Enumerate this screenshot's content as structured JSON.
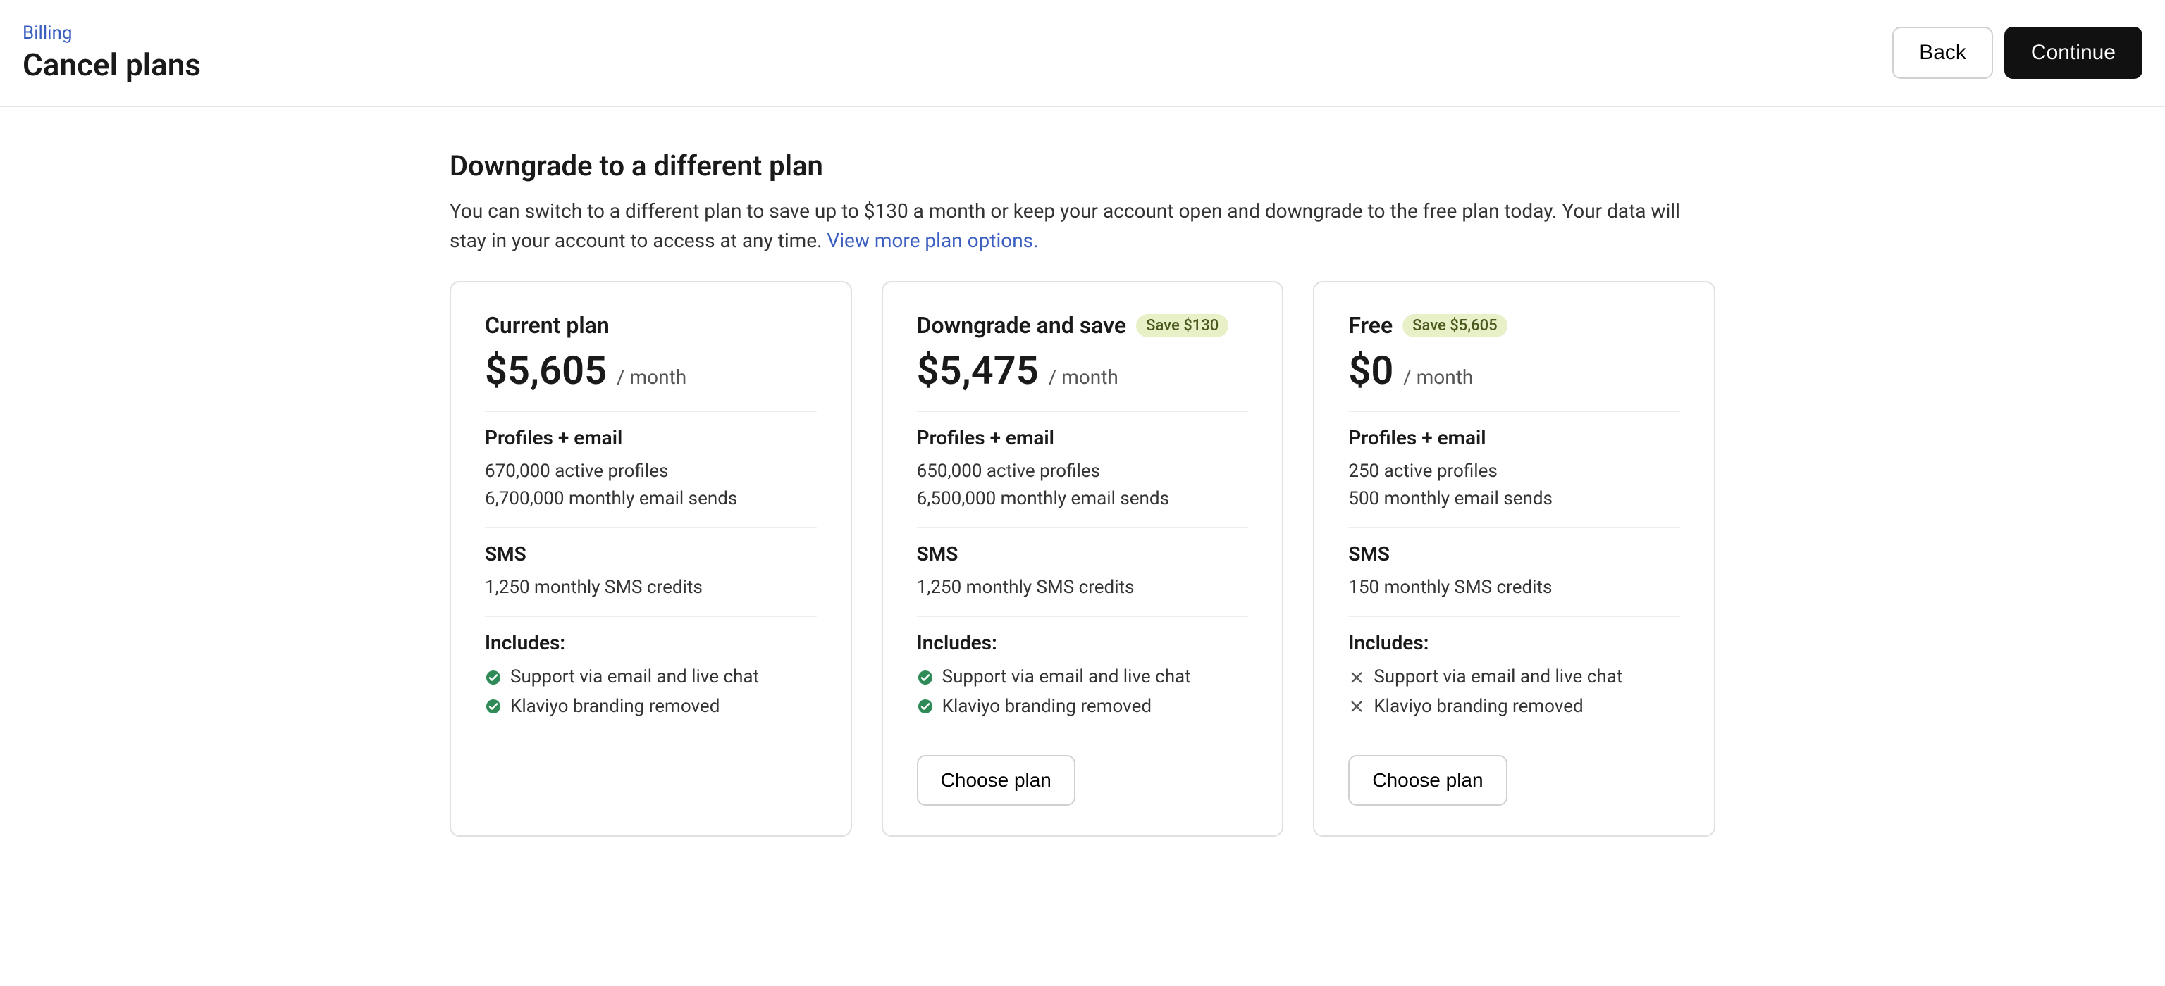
{
  "breadcrumb": "Billing",
  "page_title": "Cancel plans",
  "buttons": {
    "back": "Back",
    "continue": "Continue",
    "choose": "Choose plan"
  },
  "section": {
    "title": "Downgrade to a different plan",
    "desc_pre": "You can switch to a different plan to save up to $130 a month or keep your account open and downgrade to the free plan today. Your data will stay in your account to access at any time. ",
    "link": "View more plan options."
  },
  "labels": {
    "profiles_email": "Profiles + email",
    "sms": "SMS",
    "includes": "Includes:",
    "per_month": "/ month"
  },
  "features": {
    "support": "Support via email and live chat",
    "branding": "Klaviyo branding removed"
  },
  "plans": [
    {
      "title": "Current plan",
      "badge": "",
      "price": "$5,605",
      "profiles": "670,000 active profiles",
      "emails": "6,700,000 monthly email sends",
      "sms_credits": "1,250 monthly SMS credits",
      "support_ok": true,
      "branding_ok": true,
      "has_choose": false
    },
    {
      "title": "Downgrade and save",
      "badge": "Save $130",
      "price": "$5,475",
      "profiles": "650,000 active profiles",
      "emails": "6,500,000 monthly email sends",
      "sms_credits": "1,250 monthly SMS credits",
      "support_ok": true,
      "branding_ok": true,
      "has_choose": true
    },
    {
      "title": "Free",
      "badge": "Save $5,605",
      "price": "$0",
      "profiles": "250 active profiles",
      "emails": "500 monthly email sends",
      "sms_credits": "150 monthly SMS credits",
      "support_ok": false,
      "branding_ok": false,
      "has_choose": true
    }
  ]
}
